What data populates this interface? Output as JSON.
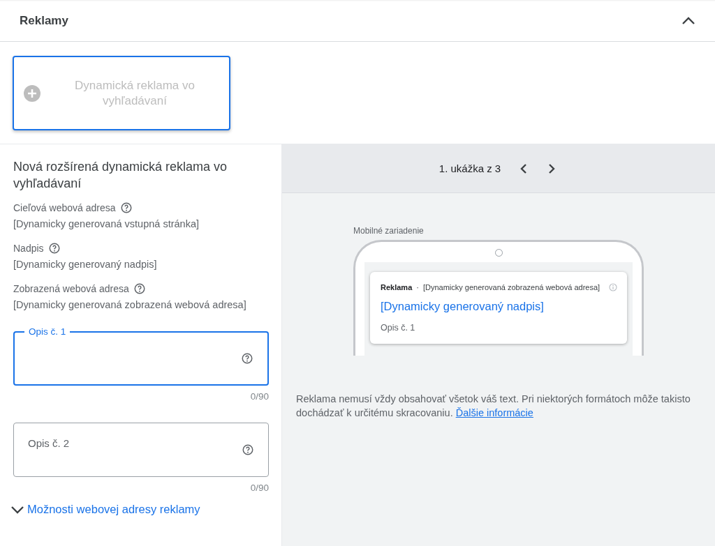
{
  "section": {
    "title": "Reklamy",
    "expanded": true
  },
  "ad_types": [
    {
      "label": "Dynamická reklama vo vyhľadávaní",
      "selected": true
    }
  ],
  "editor": {
    "title": "Nová rozšírená dynamická reklama vo vyhľadávaní",
    "info": [
      {
        "label": "Cieľová webová adresa",
        "value": "[Dynamicky generovaná vstupná stránka]"
      },
      {
        "label": "Nadpis",
        "value": "[Dynamicky generovaný nadpis]"
      },
      {
        "label": "Zobrazená webová adresa",
        "value": "[Dynamicky generovaná zobrazená webová adresa]"
      }
    ],
    "fields": [
      {
        "label": "Opis č. 1",
        "focused": true,
        "counter": "0/90"
      },
      {
        "label": "Opis č. 2",
        "focused": false,
        "counter": "0/90"
      }
    ],
    "options_link": {
      "label": "Možnosti webovej adresy reklamy",
      "expanded": false
    }
  },
  "preview": {
    "pager": "1. ukážka z 3",
    "device": "Mobilné zariadenie",
    "ad": {
      "badge": "Reklama",
      "separator": "·",
      "url": "[Dynamicky generovaná zobrazená webová adresa]",
      "headline": "[Dynamicky generovaný nadpis]",
      "description": "Opis č. 1"
    },
    "note": {
      "text": "Reklama nemusí vždy obsahovať všetok váš text. Pri niektorých formátoch môže takisto dochádzať k určitému skracovaniu.",
      "link": "Ďalšie informácie"
    }
  }
}
